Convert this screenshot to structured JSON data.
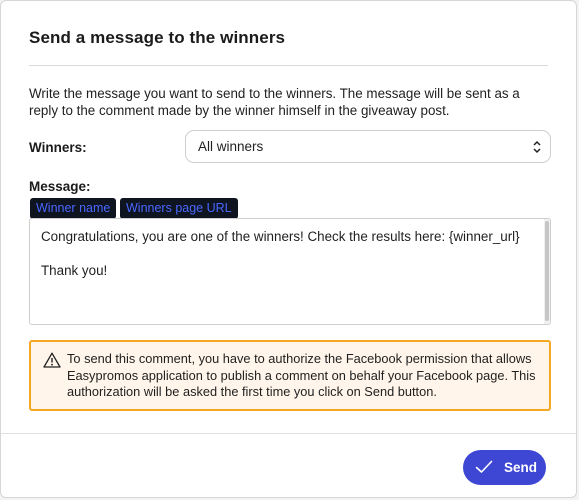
{
  "modal": {
    "title": "Send a message to the winners",
    "description": "Write the message you want to send to the winners. The message will be sent as a reply to the comment made by the winner himself in the giveaway post."
  },
  "winners": {
    "label": "Winners:",
    "selected": "All winners"
  },
  "message": {
    "label": "Message:",
    "tags": [
      "Winner name",
      "Winners page URL"
    ],
    "text": "Congratulations, you are one of the winners! Check the results here: {winner_url}\n\nThank you!"
  },
  "warning": {
    "text": "To send this comment, you have to authorize the Facebook permission that allows Easypromos application to publish a comment on behalf your Facebook page. This authorization will be asked the first time you click on Send button.",
    "icon": "warning-triangle-icon",
    "border_color": "#f5a623",
    "background_color": "#fff5ea"
  },
  "footer": {
    "send_label": "Send",
    "send_icon": "check-icon",
    "accent_color": "#3e46d4"
  }
}
